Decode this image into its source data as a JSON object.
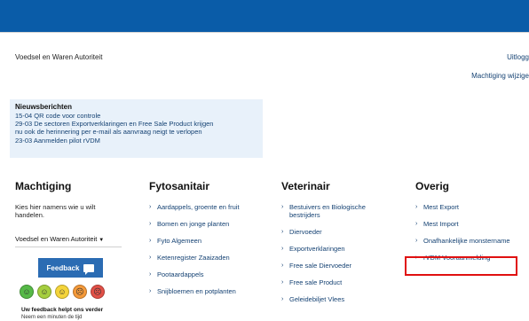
{
  "header": {
    "organization": "Voedsel en Waren Autoriteit",
    "logout_label": "Uitlogg",
    "change_mandate_label": "Machtiging wijzige"
  },
  "news": {
    "title": "Nieuwsberichten",
    "items": [
      "15-04 QR code voor controle",
      "29-03 De sectoren Exportverklaringen en Free Sale Product krijgen",
      "nu ook de herinnering per e-mail als aanvraag neigt te verlopen",
      "23-03 Aanmelden pilot rVDM"
    ]
  },
  "columns": {
    "machtiging": {
      "title": "Machtiging",
      "text": "Kies hier namens wie u wilt handelen.",
      "selected": "Voedsel en Waren Autoriteit",
      "feedback_label": "Feedback",
      "feedback_text": "Uw feedback helpt ons verder",
      "feedback_sub": "Neem een minuten de tijd"
    },
    "fytosanitair": {
      "title": "Fytosanitair",
      "items": [
        "Aardappels, groente en fruit",
        "Bomen en jonge planten",
        "Fyto Algemeen",
        "Ketenregister Zaaizaden",
        "Pootaardappels",
        "Snijbloemen en potplanten"
      ]
    },
    "veterinair": {
      "title": "Veterinair",
      "items": [
        "Bestuivers en Biologische bestrijders",
        "Diervoeder",
        "Exportverklaringen",
        "Free sale Diervoeder",
        "Free sale Product",
        "Geleidebiljet Vlees"
      ]
    },
    "overig": {
      "title": "Overig",
      "items": [
        "Mest Export",
        "Mest Import",
        "Onafhankelijke monstername",
        "rVDM Vooraanmelding"
      ]
    }
  },
  "colors": {
    "header_blue": "#0a5ca8",
    "link_blue": "#154273",
    "news_bg": "#e8f1fa",
    "highlight_red": "#e01010",
    "faces": [
      "#56b947",
      "#a6cf3f",
      "#f4d43a",
      "#f59a3a",
      "#e25047"
    ]
  }
}
